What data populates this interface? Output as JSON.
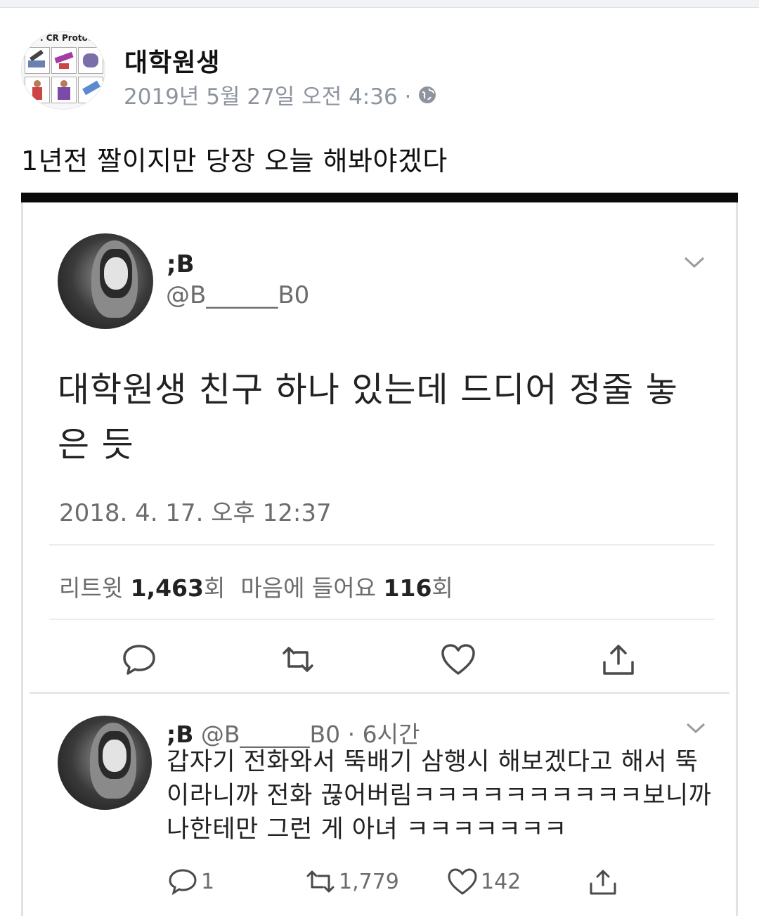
{
  "post": {
    "page_name": "대학원생",
    "date": "2019년 5월 27일 오전 4:36 ·",
    "text": "1년전 짤이지만 당장 오늘 해봐야겠다",
    "avatar": {
      "title": ". CR Protoco."
    }
  },
  "tweet": {
    "name": ";B",
    "handle": "@B______B0",
    "body": "대학원생 친구 하나 있는데 드디어 정줄 놓은 듯",
    "time": "2018. 4. 17. 오후 12:37",
    "stats": {
      "retweet_label": "리트윗",
      "retweet_count": "1,463",
      "retweet_unit": "회",
      "like_label": "마음에 들어요",
      "like_count": "116",
      "like_unit": "회"
    }
  },
  "reply": {
    "name": ";B",
    "meta": "@B______B0 · 6시간",
    "body": "갑자기 전화와서 뚝배기 삼행시 해보겠다고 해서 뚝이라니까 전화 끊어버림ㅋㅋㅋㅋㅋㅋㅋㅋㅋㅋ보니까 나한테만 그런 게 아녀 ㅋㅋㅋㅋㅋㅋㅋ",
    "reply_count": "1",
    "retweet_count": "1,779",
    "like_count": "142"
  },
  "icons": [
    "globe-icon",
    "chevron-down-icon",
    "reply-icon",
    "retweet-icon",
    "like-icon",
    "share-icon"
  ]
}
